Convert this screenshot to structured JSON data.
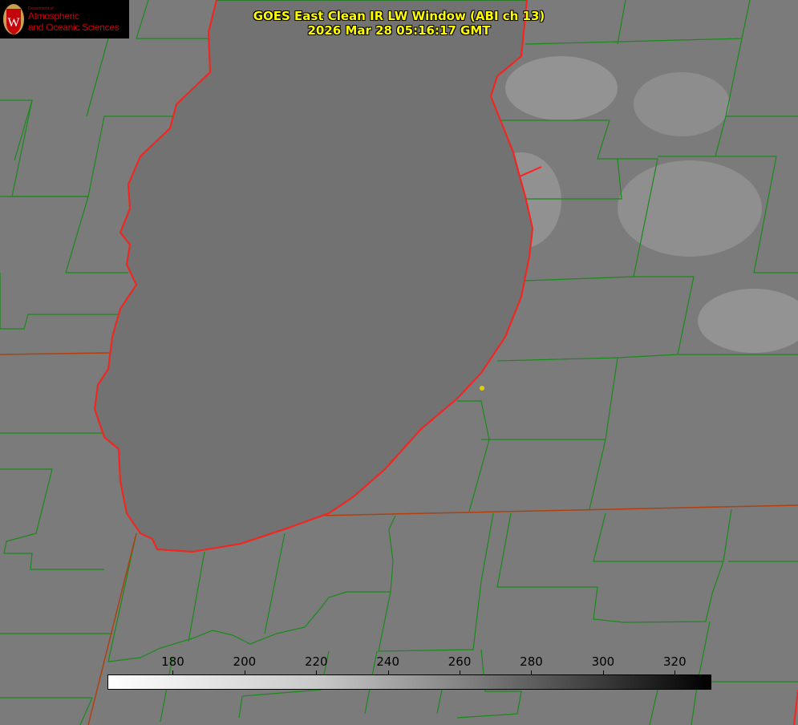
{
  "title": {
    "line1": "GOES East Clean IR LW Window (ABI ch 13)",
    "line2": "2026 Mar 28 05:16:17 GMT"
  },
  "logo": {
    "dept": "Department of",
    "line1": "Atmospheric",
    "line2": "and Oceanic Sciences",
    "seal_letter": "W"
  },
  "colorbar": {
    "min": 162,
    "max": 330,
    "ticks": [
      "180",
      "200",
      "220",
      "240",
      "260",
      "280",
      "300",
      "320"
    ],
    "tick_values": [
      180,
      200,
      220,
      240,
      260,
      280,
      300,
      320
    ]
  },
  "colors": {
    "coast": "#ff2020",
    "county": "#1a8a1a",
    "marker": "#e0d000",
    "title": "#ffff00"
  }
}
